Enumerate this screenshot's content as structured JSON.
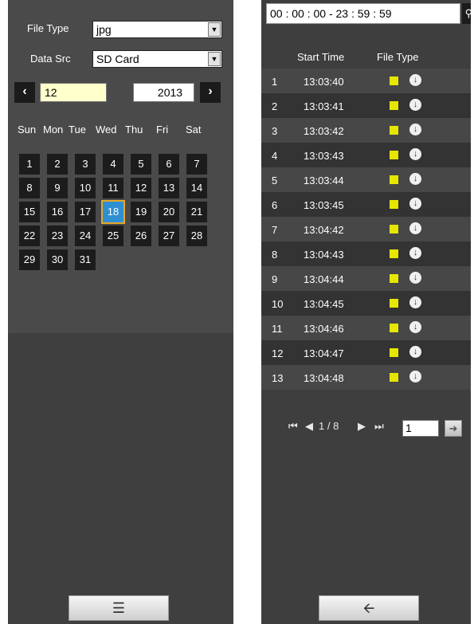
{
  "left": {
    "file_type_label": "File Type",
    "file_type_value": "jpg",
    "data_src_label": "Data Src",
    "data_src_value": "SD Card",
    "month": "12",
    "year": "2013",
    "prev_icon": "chevron-left-icon",
    "next_icon": "chevron-right-icon",
    "weekdays": [
      "Sun",
      "Mon",
      "Tue",
      "Wed",
      "Thu",
      "Fri",
      "Sat"
    ],
    "days": [
      "1",
      "2",
      "3",
      "4",
      "5",
      "6",
      "7",
      "8",
      "9",
      "10",
      "11",
      "12",
      "13",
      "14",
      "15",
      "16",
      "17",
      "18",
      "19",
      "20",
      "21",
      "22",
      "23",
      "24",
      "25",
      "26",
      "27",
      "28",
      "29",
      "30",
      "31"
    ],
    "selected_day": "18",
    "first_weekday_index": 0,
    "list_button_icon": "list-icon"
  },
  "right": {
    "time_range": "00 : 00 : 00 - 23 : 59 : 59",
    "search_icon": "search-icon",
    "header_start_time": "Start Time",
    "header_file_type": "File Type",
    "rows": [
      {
        "num": "1",
        "time": "13:03:40"
      },
      {
        "num": "2",
        "time": "13:03:41"
      },
      {
        "num": "3",
        "time": "13:03:42"
      },
      {
        "num": "4",
        "time": "13:03:43"
      },
      {
        "num": "5",
        "time": "13:03:44"
      },
      {
        "num": "6",
        "time": "13:03:45"
      },
      {
        "num": "7",
        "time": "13:04:42"
      },
      {
        "num": "8",
        "time": "13:04:43"
      },
      {
        "num": "9",
        "time": "13:04:44"
      },
      {
        "num": "10",
        "time": "13:04:45"
      },
      {
        "num": "11",
        "time": "13:04:46"
      },
      {
        "num": "12",
        "time": "13:04:47"
      },
      {
        "num": "13",
        "time": "13:04:48"
      }
    ],
    "file_type_color": "#e6e600",
    "download_icon": "download-icon",
    "pager_text": "1 / 8",
    "page_input": "1",
    "back_button_icon": "arrow-left-icon"
  }
}
